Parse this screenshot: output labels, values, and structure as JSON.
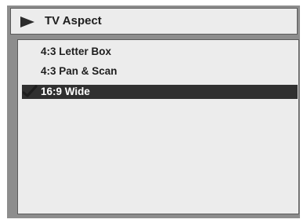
{
  "menu": {
    "title": "TV Aspect",
    "options": [
      {
        "label": "4:3 Letter Box",
        "selected": false
      },
      {
        "label": "4:3 Pan & Scan",
        "selected": false
      },
      {
        "label": "16:9 Wide",
        "selected": true
      }
    ]
  },
  "icons": {
    "title_icon": "play-arrow-icon",
    "selected_icon": "checkmark-icon"
  },
  "colors": {
    "frame": "#8d8d8d",
    "panel": "#ececec",
    "highlight": "#303030",
    "highlight_text": "#ffffff",
    "text": "#1e1e1e"
  }
}
